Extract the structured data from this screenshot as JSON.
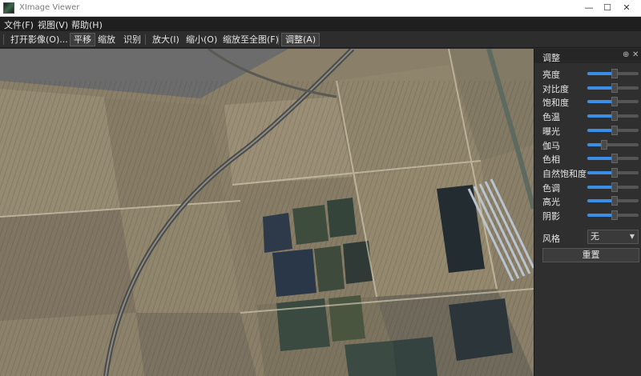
{
  "window": {
    "title": "XImage Viewer",
    "minimize": "—",
    "maximize": "☐",
    "close": "✕"
  },
  "menu": {
    "file": "文件(F)",
    "view": "视图(V)",
    "help": "帮助(H)"
  },
  "toolbar": {
    "open": "打开影像(O)...",
    "pan": "平移",
    "zoom": "缩放",
    "identify": "识别",
    "zoom_in": "放大(I)",
    "zoom_out": "缩小(O)",
    "zoom_full": "缩放至全图(F)",
    "adjust": "调整(A)"
  },
  "panel": {
    "title": "调整",
    "pin_icon": "pin-icon",
    "close_icon": "close-icon",
    "sliders": [
      {
        "label": "亮度",
        "value": 0.5
      },
      {
        "label": "对比度",
        "value": 0.5
      },
      {
        "label": "饱和度",
        "value": 0.5
      },
      {
        "label": "色温",
        "value": 0.5
      },
      {
        "label": "曝光",
        "value": 0.5
      },
      {
        "label": "伽马",
        "value": 0.3
      },
      {
        "label": "色相",
        "value": 0.5
      },
      {
        "label": "自然饱和度",
        "value": 0.5
      },
      {
        "label": "色调",
        "value": 0.5
      },
      {
        "label": "高光",
        "value": 0.5
      },
      {
        "label": "阴影",
        "value": 0.5
      }
    ],
    "style_label": "风格",
    "style_value": "无",
    "reset_label": "重置"
  },
  "colors": {
    "accent": "#3a8ee6",
    "menubar": "#1f1f1f",
    "panel": "#2f2f2f"
  }
}
